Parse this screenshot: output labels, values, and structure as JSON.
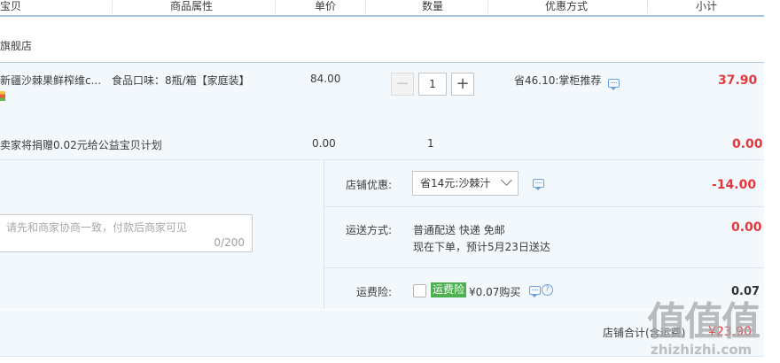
{
  "header": {
    "columns": [
      "宝贝",
      "商品属性",
      "单价",
      "数量",
      "优惠方式",
      "小计"
    ]
  },
  "shop": {
    "name": "旗舰店"
  },
  "item": {
    "title": "新疆沙棘果鲜榨维c...",
    "attr": "食品口味：8瓶/箱【家庭装】",
    "unit_price": "84.00",
    "quantity": "1",
    "decrease_label": "−",
    "increase_label": "+",
    "discount": "省46.10:掌柜推荐",
    "subtotal": "37.90"
  },
  "charity": {
    "title": "卖家将捐赠0.02元给公益宝贝计划",
    "unit_price": "0.00",
    "quantity": "1",
    "subtotal": "0.00"
  },
  "memo": {
    "placeholder": "请先和商家协商一致，付款后商家可见",
    "counter": "0/200"
  },
  "store_discount": {
    "label": "店铺优惠:",
    "selected": "省14元:沙棘汁",
    "amount": "-14.00"
  },
  "shipping": {
    "label": "运送方式:",
    "method": "普通配送 快递 免邮",
    "eta": "现在下单，预计5月23日送达",
    "amount": "0.00"
  },
  "insurance": {
    "label": "运费险:",
    "badge": "运费险",
    "price_text": "¥0.07购买",
    "amount": "0.07"
  },
  "total": {
    "label": "店铺合计(含运费)",
    "amount": "¥23.90"
  },
  "watermark": {
    "main": "值值值",
    "sub": "zhizhizhi.com"
  },
  "colors": {
    "accent_red": "#e4393c",
    "link_blue": "#6ea0de",
    "badge_green": "#4caf50"
  }
}
